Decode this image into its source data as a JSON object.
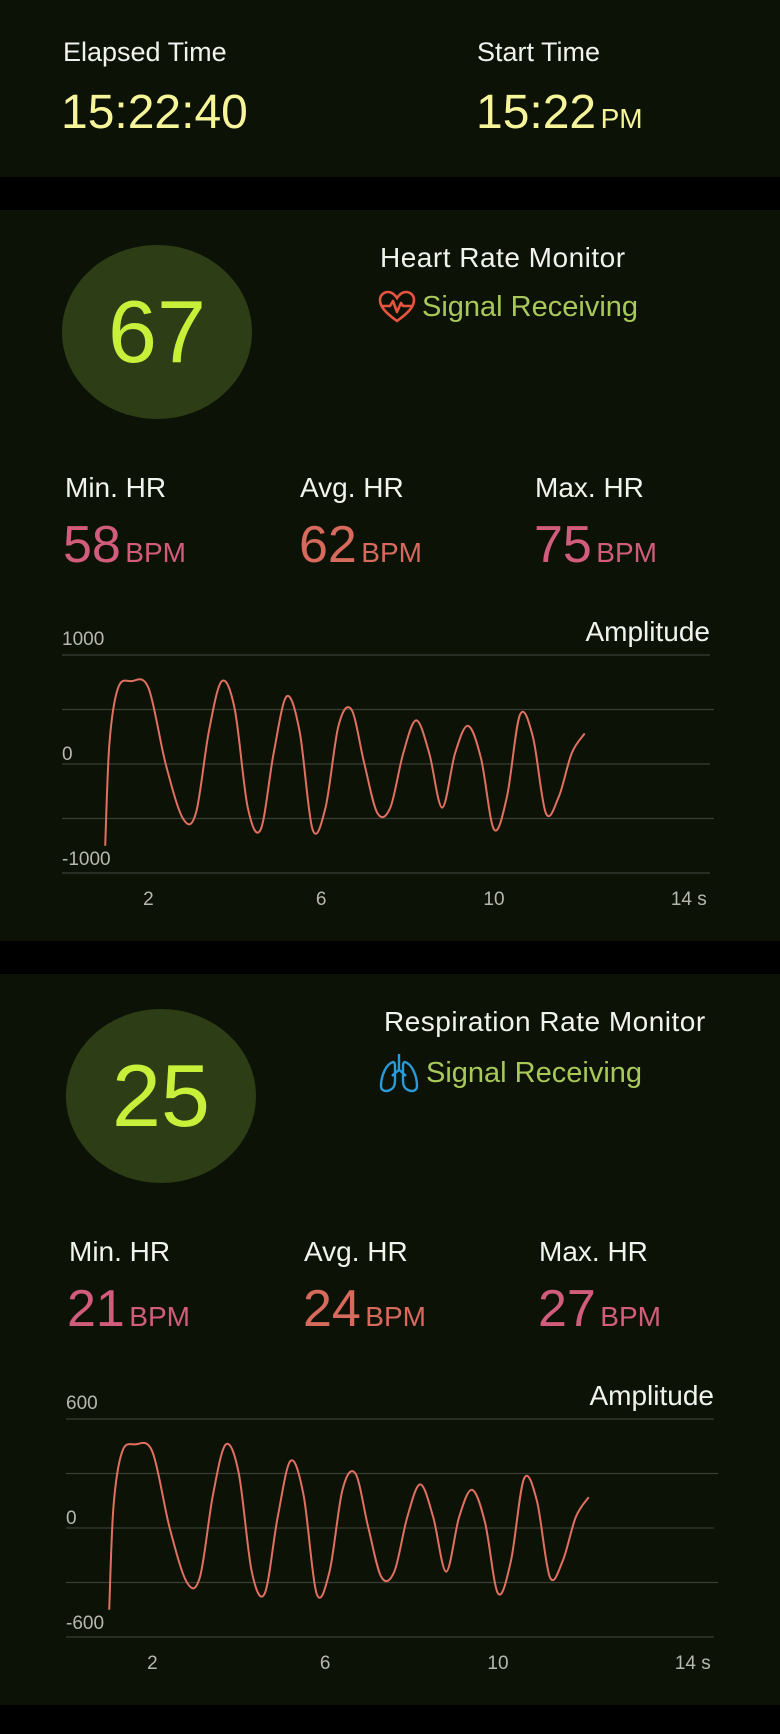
{
  "header": {
    "elapsed_label": "Elapsed Time",
    "elapsed_value": "15:22:40",
    "start_label": "Start Time",
    "start_value": "15:22",
    "start_unit": "PM"
  },
  "heart": {
    "value": "67",
    "title": "Heart Rate Monitor",
    "status": "Signal Receiving",
    "icon": "heart-pulse-icon",
    "stats": [
      {
        "label": "Min. HR",
        "value": "58",
        "unit": "BPM"
      },
      {
        "label": "Avg. HR",
        "value": "62",
        "unit": "BPM"
      },
      {
        "label": "Max. HR",
        "value": "75",
        "unit": "BPM"
      }
    ]
  },
  "respiration": {
    "value": "25",
    "title": "Respiration Rate Monitor",
    "status": "Signal Receiving",
    "icon": "lungs-icon",
    "stats": [
      {
        "label": "Min. HR",
        "value": "21",
        "unit": "BPM"
      },
      {
        "label": "Avg. HR",
        "value": "24",
        "unit": "BPM"
      },
      {
        "label": "Max. HR",
        "value": "27",
        "unit": "BPM"
      }
    ]
  },
  "colors": {
    "background": "#0d1206",
    "time_text": "#f7f59a",
    "value_green": "#c7f03a",
    "status_green": "#a8c85a",
    "stat_pink": "#d25c7c",
    "stat_salmon": "#d66a5c",
    "line": "#e0705f",
    "heart_icon": "#e8553e",
    "lungs_icon": "#2a9ad8"
  },
  "chart_data": [
    {
      "type": "line",
      "ylabel": "Amplitude",
      "ylim": [
        -1000,
        1000
      ],
      "yticks": [
        "1000",
        "0",
        "-1000"
      ],
      "xlim": [
        0,
        15
      ],
      "xticks": [
        "2",
        "6",
        "10",
        "14 s"
      ],
      "grid": true,
      "x": [
        1,
        1.1,
        1.3,
        1.6,
        2.0,
        2.4,
        2.8,
        3.1,
        3.4,
        3.7,
        4.0,
        4.3,
        4.6,
        4.9,
        5.2,
        5.5,
        5.8,
        6.1,
        6.4,
        6.7,
        7.0,
        7.3,
        7.6,
        7.9,
        8.2,
        8.5,
        8.8,
        9.1,
        9.4,
        9.7,
        10.0,
        10.3,
        10.6,
        10.9,
        11.2,
        11.5,
        11.8,
        12.1
      ],
      "series": [
        {
          "values": [
            -750,
            200,
            700,
            760,
            700,
            0,
            -500,
            -450,
            300,
            760,
            500,
            -400,
            -600,
            100,
            620,
            300,
            -600,
            -400,
            350,
            500,
            0,
            -450,
            -400,
            100,
            400,
            100,
            -400,
            100,
            350,
            50,
            -600,
            -300,
            450,
            250,
            -450,
            -300,
            100,
            280
          ]
        }
      ]
    },
    {
      "type": "line",
      "ylabel": "Amplitude",
      "ylim": [
        -600,
        600
      ],
      "yticks": [
        "600",
        "0",
        "-600"
      ],
      "xlim": [
        0,
        15
      ],
      "xticks": [
        "2",
        "6",
        "10",
        "14 s"
      ],
      "grid": true,
      "x": [
        1,
        1.1,
        1.3,
        1.6,
        2.0,
        2.4,
        2.8,
        3.1,
        3.4,
        3.7,
        4.0,
        4.3,
        4.6,
        4.9,
        5.2,
        5.5,
        5.8,
        6.1,
        6.4,
        6.7,
        7.0,
        7.3,
        7.6,
        7.9,
        8.2,
        8.5,
        8.8,
        9.1,
        9.4,
        9.7,
        10.0,
        10.3,
        10.6,
        10.9,
        11.2,
        11.5,
        11.8,
        12.1
      ],
      "series": [
        {
          "values": [
            -450,
            120,
            420,
            460,
            420,
            0,
            -300,
            -270,
            180,
            460,
            300,
            -240,
            -360,
            60,
            370,
            180,
            -360,
            -240,
            210,
            300,
            0,
            -270,
            -240,
            60,
            240,
            60,
            -240,
            60,
            210,
            30,
            -360,
            -180,
            270,
            150,
            -270,
            -180,
            60,
            170
          ]
        }
      ]
    }
  ]
}
